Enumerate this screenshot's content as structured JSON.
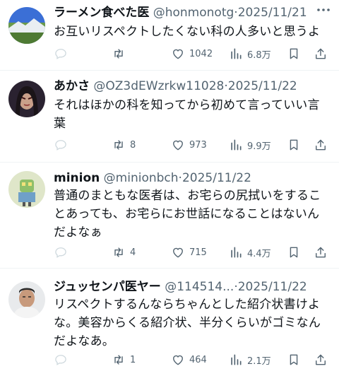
{
  "posts": [
    {
      "name": "ラーメン食べた医",
      "handle": "@honmonotg",
      "dot": "·",
      "date": "2025/11/21",
      "text_lines": [
        "お互いリスペクトしたくない科の人多いと思うよ"
      ],
      "replies": "",
      "reposts": "",
      "likes": "1042",
      "views": "6.8万"
    },
    {
      "name": "あかさ",
      "handle": "@OZ3dEWzrkw11028",
      "dot": "·",
      "date": "2025/11/22",
      "text_lines": [
        "それはほかの科を知ってから初めて言っていい言",
        "葉"
      ],
      "replies": "",
      "reposts": "8",
      "likes": "973",
      "views": "9.9万"
    },
    {
      "name": "minion",
      "handle": "@minionbch",
      "dot": "·",
      "date": "2025/11/22",
      "text_lines": [
        "普通のまともな医者は、お宅らの尻拭いをするこ",
        "とあっても、お宅らにお世話になることはないん",
        "だよなぁ"
      ],
      "replies": "",
      "reposts": "4",
      "likes": "715",
      "views": "4.4万"
    },
    {
      "name": "ジュッセンパ医ヤー",
      "handle": "@114514...",
      "dot": "·",
      "date": "2025/11/22",
      "text_lines": [
        "リスペクトするんならちゃんとした紹介状書けよ",
        "な。美容からくる紹介状、半分くらいがゴミなん",
        "だよなあ。"
      ],
      "replies": "",
      "reposts": "1",
      "likes": "464",
      "views": "2.1万"
    }
  ],
  "icons": {
    "more": "more-dots-icon",
    "reply": "reply-icon",
    "repost": "repost-icon",
    "like": "heart-icon",
    "views": "views-chart-icon",
    "bookmark": "bookmark-icon",
    "share": "share-icon"
  },
  "colors": {
    "text": "#0f1419",
    "secondary": "#536471",
    "divider": "#eff3f4"
  }
}
